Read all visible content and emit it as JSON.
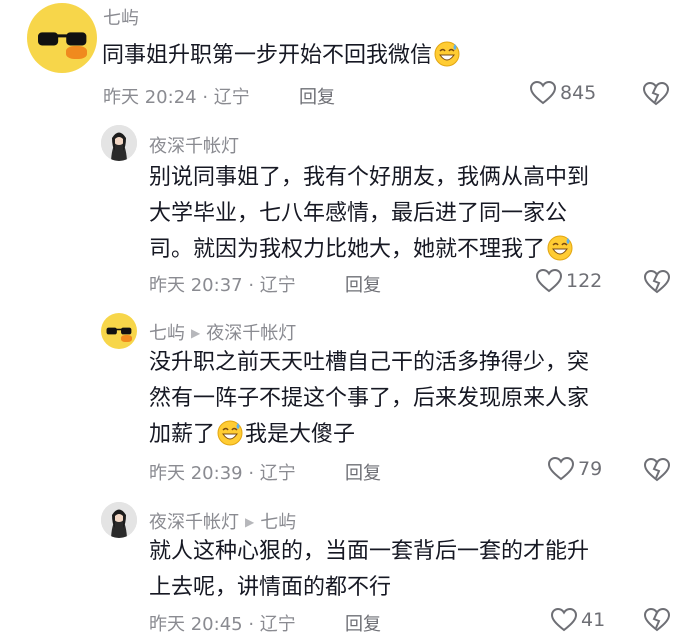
{
  "comments": [
    {
      "user": "七屿",
      "text_lines": [
        "同事姐升职第一步开始不回我微信"
      ],
      "time": "昨天 20:24",
      "location": "辽宁",
      "reply_label": "回复",
      "likes": "845",
      "avatar": "duck-sunglasses"
    },
    {
      "user": "夜深千帐灯",
      "text_lines": [
        "别说同事姐了，我有个好朋友，我俩从高中到",
        "大学毕业，七八年感情，最后进了同一家公",
        "司。就因为我权力比她大，她就不理我了"
      ],
      "time": "昨天 20:37",
      "location": "辽宁",
      "reply_label": "回复",
      "likes": "122",
      "avatar": "girl-photo"
    },
    {
      "user": "七屿",
      "reply_to": "夜深千帐灯",
      "text_lines": [
        "没升职之前天天吐槽自己干的活多挣得少，突",
        "然有一阵子不提这个事了，后来发现原来人家",
        "加薪了",
        "我是大傻子"
      ],
      "time": "昨天 20:39",
      "location": "辽宁",
      "reply_label": "回复",
      "likes": "79",
      "avatar": "duck-sunglasses"
    },
    {
      "user": "夜深千帐灯",
      "reply_to": "七屿",
      "text_lines": [
        "就人这种心狠的，当面一套背后一套的才能升",
        "上去呢，讲情面的都不行"
      ],
      "time": "昨天 20:45",
      "location": "辽宁",
      "reply_label": "回复",
      "likes": "41",
      "avatar": "girl-photo"
    }
  ],
  "colors": {
    "text": "#161823",
    "secondary": "#8a8b91",
    "icon": "#6e6f75",
    "emoji": "#ffcc33"
  },
  "icons": [
    "heart-outline-icon",
    "broken-heart-icon",
    "grin-sweat-emoji",
    "triangle-arrow-icon"
  ]
}
